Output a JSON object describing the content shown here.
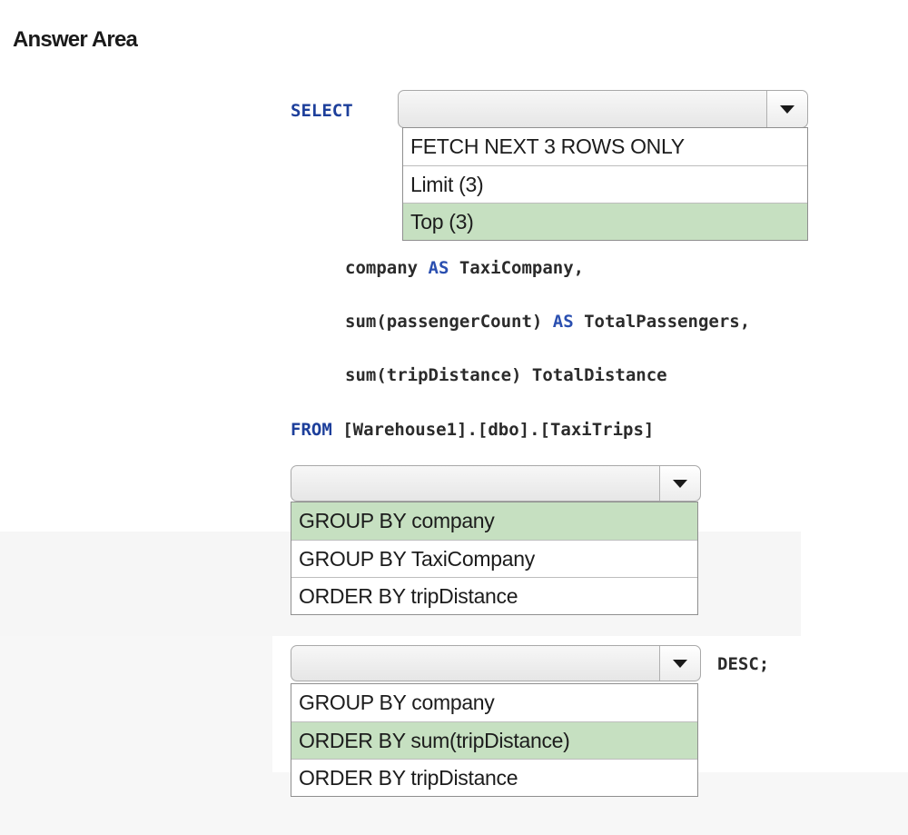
{
  "header": {
    "title": "Answer Area"
  },
  "code": {
    "select_kw": "SELECT",
    "line1_a": "company ",
    "line1_kw": "AS",
    "line1_b": " TaxiCompany,",
    "line2_a": "sum(passengerCount) ",
    "line2_kw": "AS",
    "line2_b": " TotalPassengers,",
    "line3": "sum(tripDistance) TotalDistance",
    "from_kw": "FROM",
    "from_rest": " [Warehouse1].[dbo].[TaxiTrips]",
    "desc": "DESC;"
  },
  "dropdowns": [
    {
      "selected_value": "",
      "options": [
        {
          "label": "FETCH NEXT 3 ROWS ONLY",
          "selected": false
        },
        {
          "label": "Limit (3)",
          "selected": false
        },
        {
          "label": "Top (3)",
          "selected": true
        }
      ]
    },
    {
      "selected_value": "",
      "options": [
        {
          "label": "GROUP BY company",
          "selected": true
        },
        {
          "label": "GROUP BY TaxiCompany",
          "selected": false
        },
        {
          "label": "ORDER BY tripDistance",
          "selected": false
        }
      ]
    },
    {
      "selected_value": "",
      "options": [
        {
          "label": "GROUP BY company",
          "selected": false
        },
        {
          "label": "ORDER BY sum(tripDistance)",
          "selected": true
        },
        {
          "label": "ORDER BY tripDistance",
          "selected": false
        }
      ]
    }
  ],
  "colors": {
    "keyword": "#1d3f9b",
    "selected_option": "#c6e0c1"
  },
  "icons": {
    "dropdown_arrow": "chevron-down-icon"
  }
}
